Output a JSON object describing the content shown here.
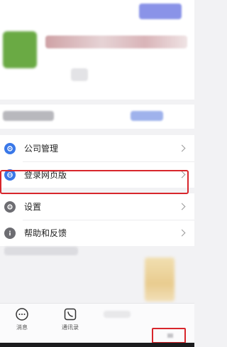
{
  "menu": {
    "items": [
      {
        "label": "公司管理",
        "icon": "company-icon",
        "color": "#3a78e8"
      },
      {
        "label": "登录网页版",
        "icon": "web-login-icon",
        "color": "#3a78e8"
      },
      {
        "label": "设置",
        "icon": "settings-gear-icon",
        "color": "#6d6d72"
      },
      {
        "label": "帮助和反馈",
        "icon": "info-icon",
        "color": "#6d6d72"
      }
    ]
  },
  "tabbar": {
    "messages_label": "消息",
    "contacts_label": "通讯录"
  },
  "colors": {
    "highlight": "#d8262c",
    "accent": "#3a78e8"
  }
}
